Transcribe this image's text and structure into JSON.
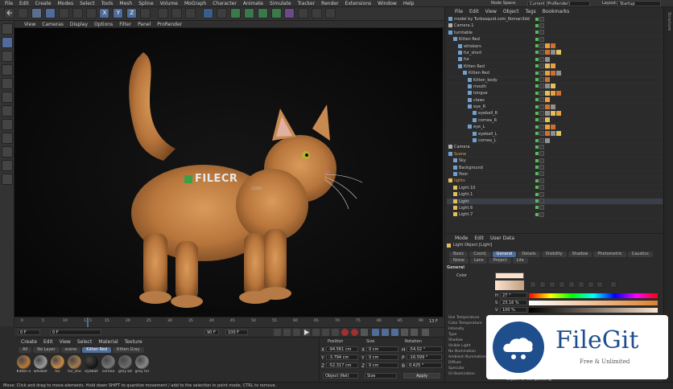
{
  "menubar": {
    "items": [
      "File",
      "Edit",
      "Create",
      "Modes",
      "Select",
      "Tools",
      "Mesh",
      "Spline",
      "Volume",
      "MoGraph",
      "Character",
      "Animate",
      "Simulate",
      "Tracker",
      "Render",
      "Extensions",
      "Window",
      "Help"
    ],
    "node_space_label": "Node Space:",
    "node_space_value": "Current (ProRender)",
    "layout_label": "Layout:",
    "layout_value": "Startup"
  },
  "toolbar": {
    "axis_labels": [
      "X",
      "Y",
      "Z"
    ]
  },
  "viewport": {
    "menu": [
      "View",
      "Cameras",
      "Display",
      "Options",
      "Filter",
      "Panel",
      "ProRender"
    ],
    "watermark": "FILECR",
    "watermark_sub": ".com"
  },
  "timeline": {
    "ticks": [
      "0",
      "5",
      "10",
      "13.5",
      "15",
      "20",
      "25",
      "30",
      "35",
      "40",
      "45",
      "50",
      "55",
      "60",
      "65",
      "70",
      "75",
      "80",
      "85",
      "90"
    ],
    "frame_marker": "13 F",
    "start_field": "0 F",
    "current_field": "0 F",
    "end_field": "90 F",
    "end2_field": "100 F"
  },
  "object_manager": {
    "menu": [
      "File",
      "Edit",
      "View",
      "Object",
      "Tags",
      "Bookmarks"
    ],
    "rows": [
      {
        "label": "model by Turbosquid.com_Roman3dd",
        "indent": 0
      },
      {
        "label": "Camera.1",
        "indent": 0
      },
      {
        "label": "turntable",
        "indent": 0
      },
      {
        "label": "Kitten Red",
        "indent": 1
      },
      {
        "label": "whiskers",
        "indent": 2
      },
      {
        "label": "fur_short",
        "indent": 2
      },
      {
        "label": "fur",
        "indent": 2
      },
      {
        "label": "Kitten Red",
        "indent": 2
      },
      {
        "label": "Kitten Red",
        "indent": 3
      },
      {
        "label": "Kitten_body",
        "indent": 4
      },
      {
        "label": "mouth",
        "indent": 4
      },
      {
        "label": "tongue",
        "indent": 4
      },
      {
        "label": "claws",
        "indent": 4
      },
      {
        "label": "eye_R",
        "indent": 4
      },
      {
        "label": "eyeball_R",
        "indent": 5
      },
      {
        "label": "cornea_R",
        "indent": 5
      },
      {
        "label": "eye_L",
        "indent": 4
      },
      {
        "label": "eyeball_L",
        "indent": 5
      },
      {
        "label": "cornea_L",
        "indent": 5
      },
      {
        "label": "Camera",
        "indent": 0
      },
      {
        "label": "Scene",
        "indent": 0
      },
      {
        "label": "Sky",
        "indent": 1
      },
      {
        "label": "Background",
        "indent": 1
      },
      {
        "label": "floor",
        "indent": 1
      },
      {
        "label": "lights",
        "indent": 0
      },
      {
        "label": "Light.10",
        "indent": 1
      },
      {
        "label": "Light.1",
        "indent": 1
      },
      {
        "label": "Light",
        "indent": 1
      },
      {
        "label": "Light.6",
        "indent": 1
      },
      {
        "label": "Light.7",
        "indent": 1
      }
    ]
  },
  "attributes": {
    "menu": [
      "Mode",
      "Edit",
      "User Data"
    ],
    "title": "Light Object [Light]",
    "tabs_row1": [
      "Basic",
      "Coord.",
      "General",
      "Details",
      "Visibility",
      "Shadow",
      "Photometric",
      "Caustics"
    ],
    "tabs_row2": [
      "Noise",
      "Lens",
      "Project",
      "Lite"
    ],
    "active_tab": "General",
    "section": "General",
    "color_label": "Color",
    "h_label": "H",
    "h_value": "27 °",
    "s_label": "S",
    "s_value": "23.16 %",
    "v_label": "V",
    "v_value": "100 %",
    "params": [
      "Use Temperature",
      "Color Temperature",
      "Intensity",
      "Type",
      "Shadow",
      "Visible Light",
      "No Illumination",
      "Ambient Illumination",
      "Diffuse",
      "Specular",
      "GI Illumination"
    ],
    "export_label": "Export to Compositing"
  },
  "material_manager": {
    "menu": [
      "Create",
      "Edit",
      "View",
      "Select",
      "Material",
      "Texture"
    ],
    "filters": [
      "All",
      "No Layer",
      "scene",
      "Kitten Red",
      "Kitten Gray"
    ],
    "materials": [
      {
        "name": "Kitten.n",
        "color": "#b87a3a"
      },
      {
        "name": "whisker",
        "color": "#9a9a9a"
      },
      {
        "name": "fur",
        "color": "#c88a4a"
      },
      {
        "name": "fur_sho",
        "color": "#a77b4e"
      },
      {
        "name": "eyeball",
        "color": "#1a1a1a"
      },
      {
        "name": "cornea",
        "color": "#777"
      },
      {
        "name": "grey kit",
        "color": "#6e6e6e"
      },
      {
        "name": "grey fur",
        "color": "#888"
      }
    ]
  },
  "coordinates": {
    "headers": [
      "Position",
      "Size",
      "Rotation"
    ],
    "rows": [
      {
        "axis": "X",
        "pos": "-94.561 cm",
        "size_axis": "X",
        "size": "0 cm",
        "rot_axis": "H",
        "rot": "-54.02 °"
      },
      {
        "axis": "Y",
        "pos": "-3.794 cm",
        "size_axis": "Y",
        "size": "0 cm",
        "rot_axis": "P",
        "rot": "-16.599 °"
      },
      {
        "axis": "Z",
        "pos": "-52.317 cm",
        "size_axis": "Z",
        "size": "0 cm",
        "rot_axis": "B",
        "rot": "0.425 °"
      }
    ],
    "mode_select": "Object (Rel)",
    "size_select": "Size",
    "apply_label": "Apply"
  },
  "status": {
    "text": "Move: Click and drag to move elements. Hold down SHIFT to quantize movement / add to the selection in point mode, CTRL to remove."
  },
  "side_tabs": {
    "right": [
      "Objects",
      "Takes",
      "Content Browser",
      "Attributes",
      "Layers",
      "Structure"
    ]
  },
  "filegit": {
    "title": "FileGit",
    "subtitle": "Free & Unlimited"
  },
  "colors": {
    "accent": "#4f6c9a",
    "bg": "#2b2b2b",
    "viewport": "#0c0c0c",
    "logo_blue": "#1f4e8c"
  }
}
